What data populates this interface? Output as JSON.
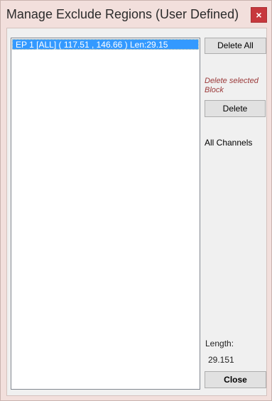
{
  "window": {
    "title": "Manage Exclude Regions (User Defined)",
    "close_glyph": "×"
  },
  "regions_list": {
    "items": [
      {
        "label": "EP 1 [ALL] ( 117.51 , 146.66 ) Len:29.15",
        "selected": true
      }
    ]
  },
  "actions": {
    "delete_all_label": "Delete All",
    "delete_hint": "Delete selected Block",
    "delete_label": "Delete",
    "channels_label": "All Channels",
    "close_label": "Close"
  },
  "length": {
    "label": "Length:",
    "value": "29.151"
  },
  "colors": {
    "selection": "#3399ff",
    "hint_text": "#9b3a3a",
    "close_button_bg": "#c7383d",
    "frame": "#f2dfdc"
  }
}
